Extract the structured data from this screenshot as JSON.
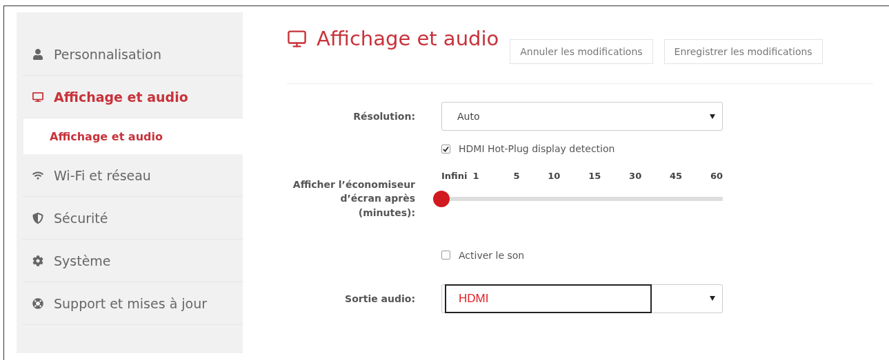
{
  "sidebar": {
    "items": [
      {
        "label": "Personnalisation",
        "selected": false
      },
      {
        "label": "Affichage et audio",
        "selected": true,
        "children": [
          {
            "label": "Affichage et audio",
            "selected": true
          }
        ]
      },
      {
        "label": "Wi-Fi et réseau",
        "selected": false
      },
      {
        "label": "Sécurité",
        "selected": false
      },
      {
        "label": "Système",
        "selected": false
      },
      {
        "label": "Support et mises à jour",
        "selected": false
      }
    ]
  },
  "header": {
    "title": "Affichage et audio",
    "buttons": [
      "Annuler les modifications",
      "Enregistrer les modifications"
    ]
  },
  "form": {
    "rows": [
      {
        "kind": "select",
        "label": "Résolution:",
        "value": "Auto"
      },
      {
        "kind": "checkbox",
        "label": "HDMI Hot-Plug display detection",
        "checked": true
      },
      {
        "kind": "slider",
        "label": "Afficher l’économiseur d’écran après (minutes):",
        "ticks": [
          "Infini",
          "1",
          "5",
          "10",
          "15",
          "30",
          "45",
          "60"
        ],
        "level": 0
      },
      {
        "kind": "checkbox",
        "label": "Activer le son",
        "checked": false
      },
      {
        "kind": "select",
        "label": "Sortie audio:",
        "value": "HDMI"
      }
    ]
  }
}
